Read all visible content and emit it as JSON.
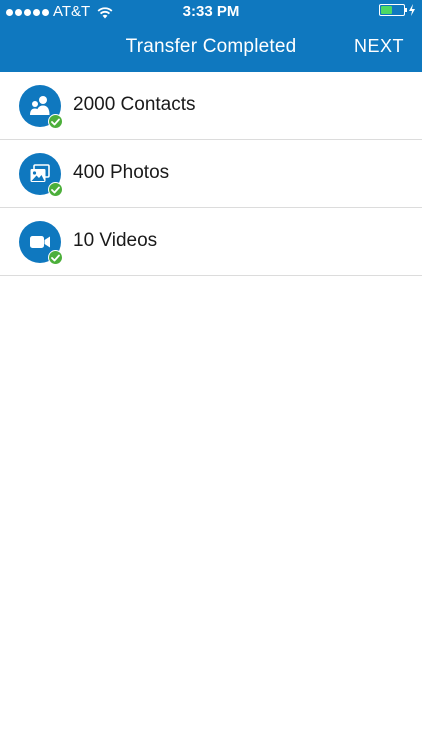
{
  "status_bar": {
    "carrier": "AT&T",
    "time": "3:33 PM",
    "battery_level": 0.5
  },
  "header": {
    "title": "Transfer Completed",
    "next_label": "NEXT"
  },
  "colors": {
    "primary": "#0f78bf",
    "check": "#4caf3b",
    "battery_fill": "#4cd964"
  },
  "items": [
    {
      "label": "2000 Contacts",
      "icon": "contacts-icon"
    },
    {
      "label": "400 Photos",
      "icon": "photos-icon"
    },
    {
      "label": "10 Videos",
      "icon": "videos-icon"
    }
  ]
}
